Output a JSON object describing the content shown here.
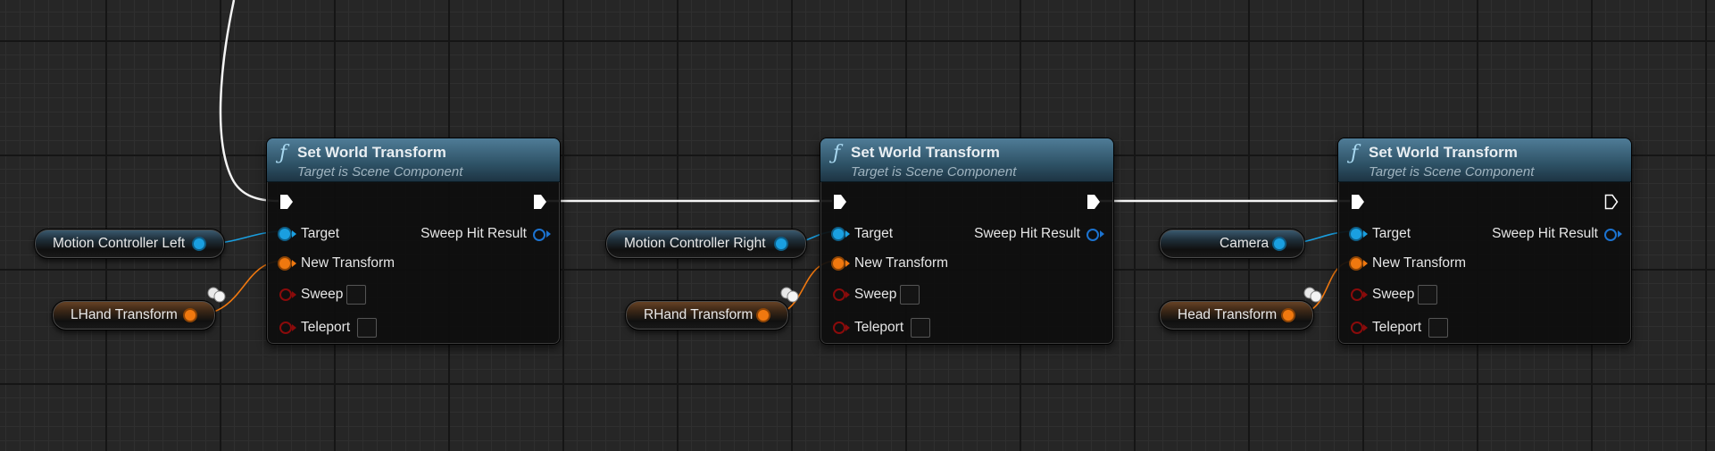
{
  "graph": {
    "nodes": [
      {
        "icon": "function-icon",
        "title": "Set World Transform",
        "subtitle": "Target is Scene Component",
        "inputs": {
          "target": "Target",
          "new_transform": "New Transform",
          "sweep": "Sweep",
          "teleport": "Teleport"
        },
        "outputs": {
          "sweep_hit_result": "Sweep Hit Result"
        }
      },
      {
        "icon": "function-icon",
        "title": "Set World Transform",
        "subtitle": "Target is Scene Component",
        "inputs": {
          "target": "Target",
          "new_transform": "New Transform",
          "sweep": "Sweep",
          "teleport": "Teleport"
        },
        "outputs": {
          "sweep_hit_result": "Sweep Hit Result"
        }
      },
      {
        "icon": "function-icon",
        "title": "Set World Transform",
        "subtitle": "Target is Scene Component",
        "inputs": {
          "target": "Target",
          "new_transform": "New Transform",
          "sweep": "Sweep",
          "teleport": "Teleport"
        },
        "outputs": {
          "sweep_hit_result": "Sweep Hit Result"
        }
      }
    ],
    "variables": [
      {
        "label": "Motion Controller Left",
        "type": "object"
      },
      {
        "label": "LHand Transform",
        "type": "transform"
      },
      {
        "label": "Motion Controller Right",
        "type": "object"
      },
      {
        "label": "RHand Transform",
        "type": "transform"
      },
      {
        "label": "Camera",
        "type": "object"
      },
      {
        "label": "Head Transform",
        "type": "transform"
      }
    ],
    "colors": {
      "exec_wire": "#ffffff",
      "object_pin": "#1a9fe0",
      "transform_pin": "#f0780f",
      "bool_pin": "#8a0b0b",
      "struct_out_pin": "#1c73d0",
      "node_header": "#3a6680"
    }
  }
}
